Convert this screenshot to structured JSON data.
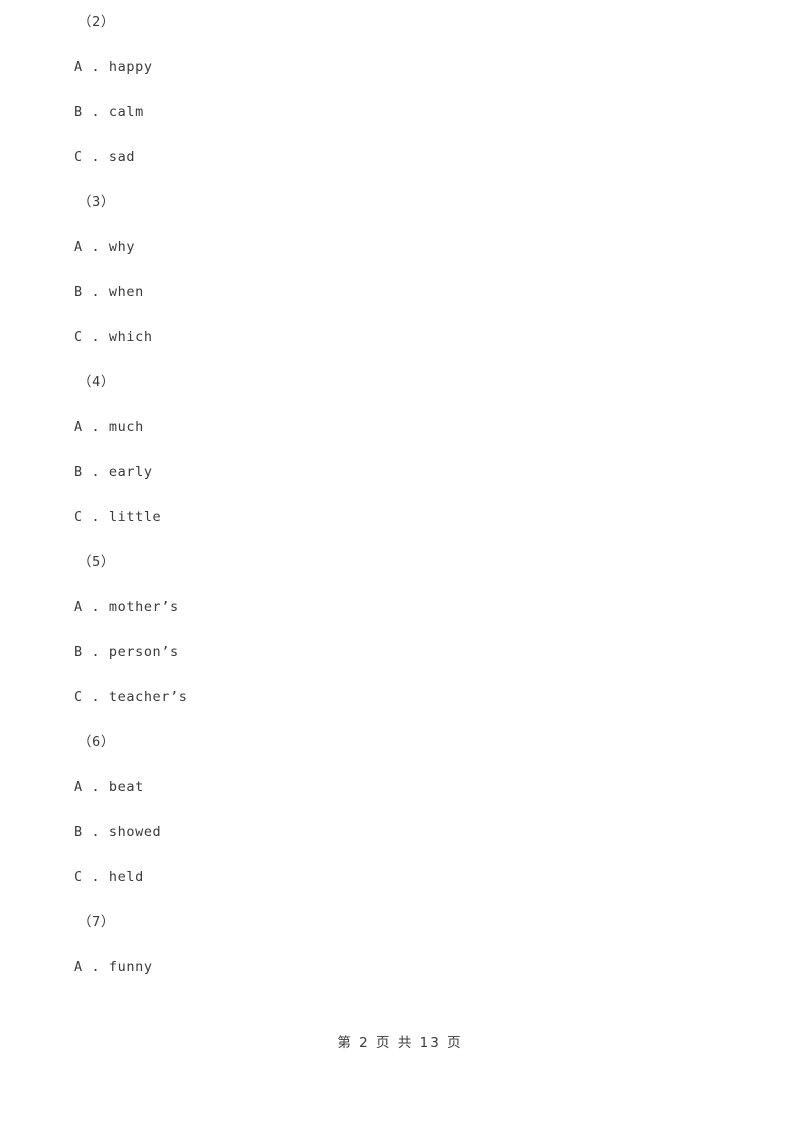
{
  "document": {
    "background_color": "#ffffff",
    "text_color": "#3a3a3a"
  },
  "blocks": [
    {
      "label": "（2）",
      "options": [
        {
          "letter": "A",
          "separator": " . ",
          "text": "happy"
        },
        {
          "letter": "B",
          "separator": " . ",
          "text": "calm"
        },
        {
          "letter": "C",
          "separator": " . ",
          "text": "sad"
        }
      ]
    },
    {
      "label": "（3）",
      "options": [
        {
          "letter": "A",
          "separator": " . ",
          "text": "why"
        },
        {
          "letter": "B",
          "separator": " . ",
          "text": "when"
        },
        {
          "letter": "C",
          "separator": " . ",
          "text": "which"
        }
      ]
    },
    {
      "label": "（4）",
      "options": [
        {
          "letter": "A",
          "separator": " . ",
          "text": "much"
        },
        {
          "letter": "B",
          "separator": " . ",
          "text": "early"
        },
        {
          "letter": "C",
          "separator": " . ",
          "text": "little"
        }
      ]
    },
    {
      "label": "（5）",
      "options": [
        {
          "letter": "A",
          "separator": " . ",
          "text": "mother’s"
        },
        {
          "letter": "B",
          "separator": " . ",
          "text": "person’s"
        },
        {
          "letter": "C",
          "separator": " . ",
          "text": "teacher’s"
        }
      ]
    },
    {
      "label": "（6）",
      "options": [
        {
          "letter": "A",
          "separator": " . ",
          "text": "beat"
        },
        {
          "letter": "B",
          "separator": " . ",
          "text": "showed"
        },
        {
          "letter": "C",
          "separator": " . ",
          "text": "held"
        }
      ]
    },
    {
      "label": "（7）",
      "options": [
        {
          "letter": "A",
          "separator": " . ",
          "text": "funny"
        }
      ]
    }
  ],
  "footer": {
    "page_text": "第 2 页 共 13 页"
  }
}
